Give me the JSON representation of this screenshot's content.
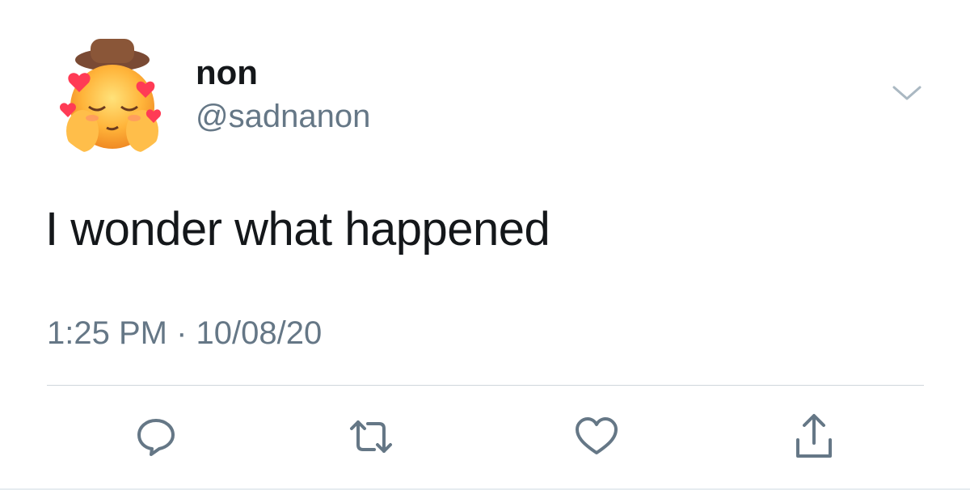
{
  "tweet": {
    "display_name": "non",
    "handle": "@sadnanon",
    "text": "I wonder what happened",
    "timestamp": "1:25 PM · 10/08/20"
  },
  "icons": {
    "avatar": "smiling-face-with-hearts-emoji",
    "menu": "chevron-down-icon",
    "reply": "reply-icon",
    "retweet": "retweet-icon",
    "like": "heart-icon",
    "share": "share-icon"
  },
  "colors": {
    "text": "#14171a",
    "secondary": "#657786",
    "icon": "#657786",
    "divider": "#cfd6dc"
  }
}
